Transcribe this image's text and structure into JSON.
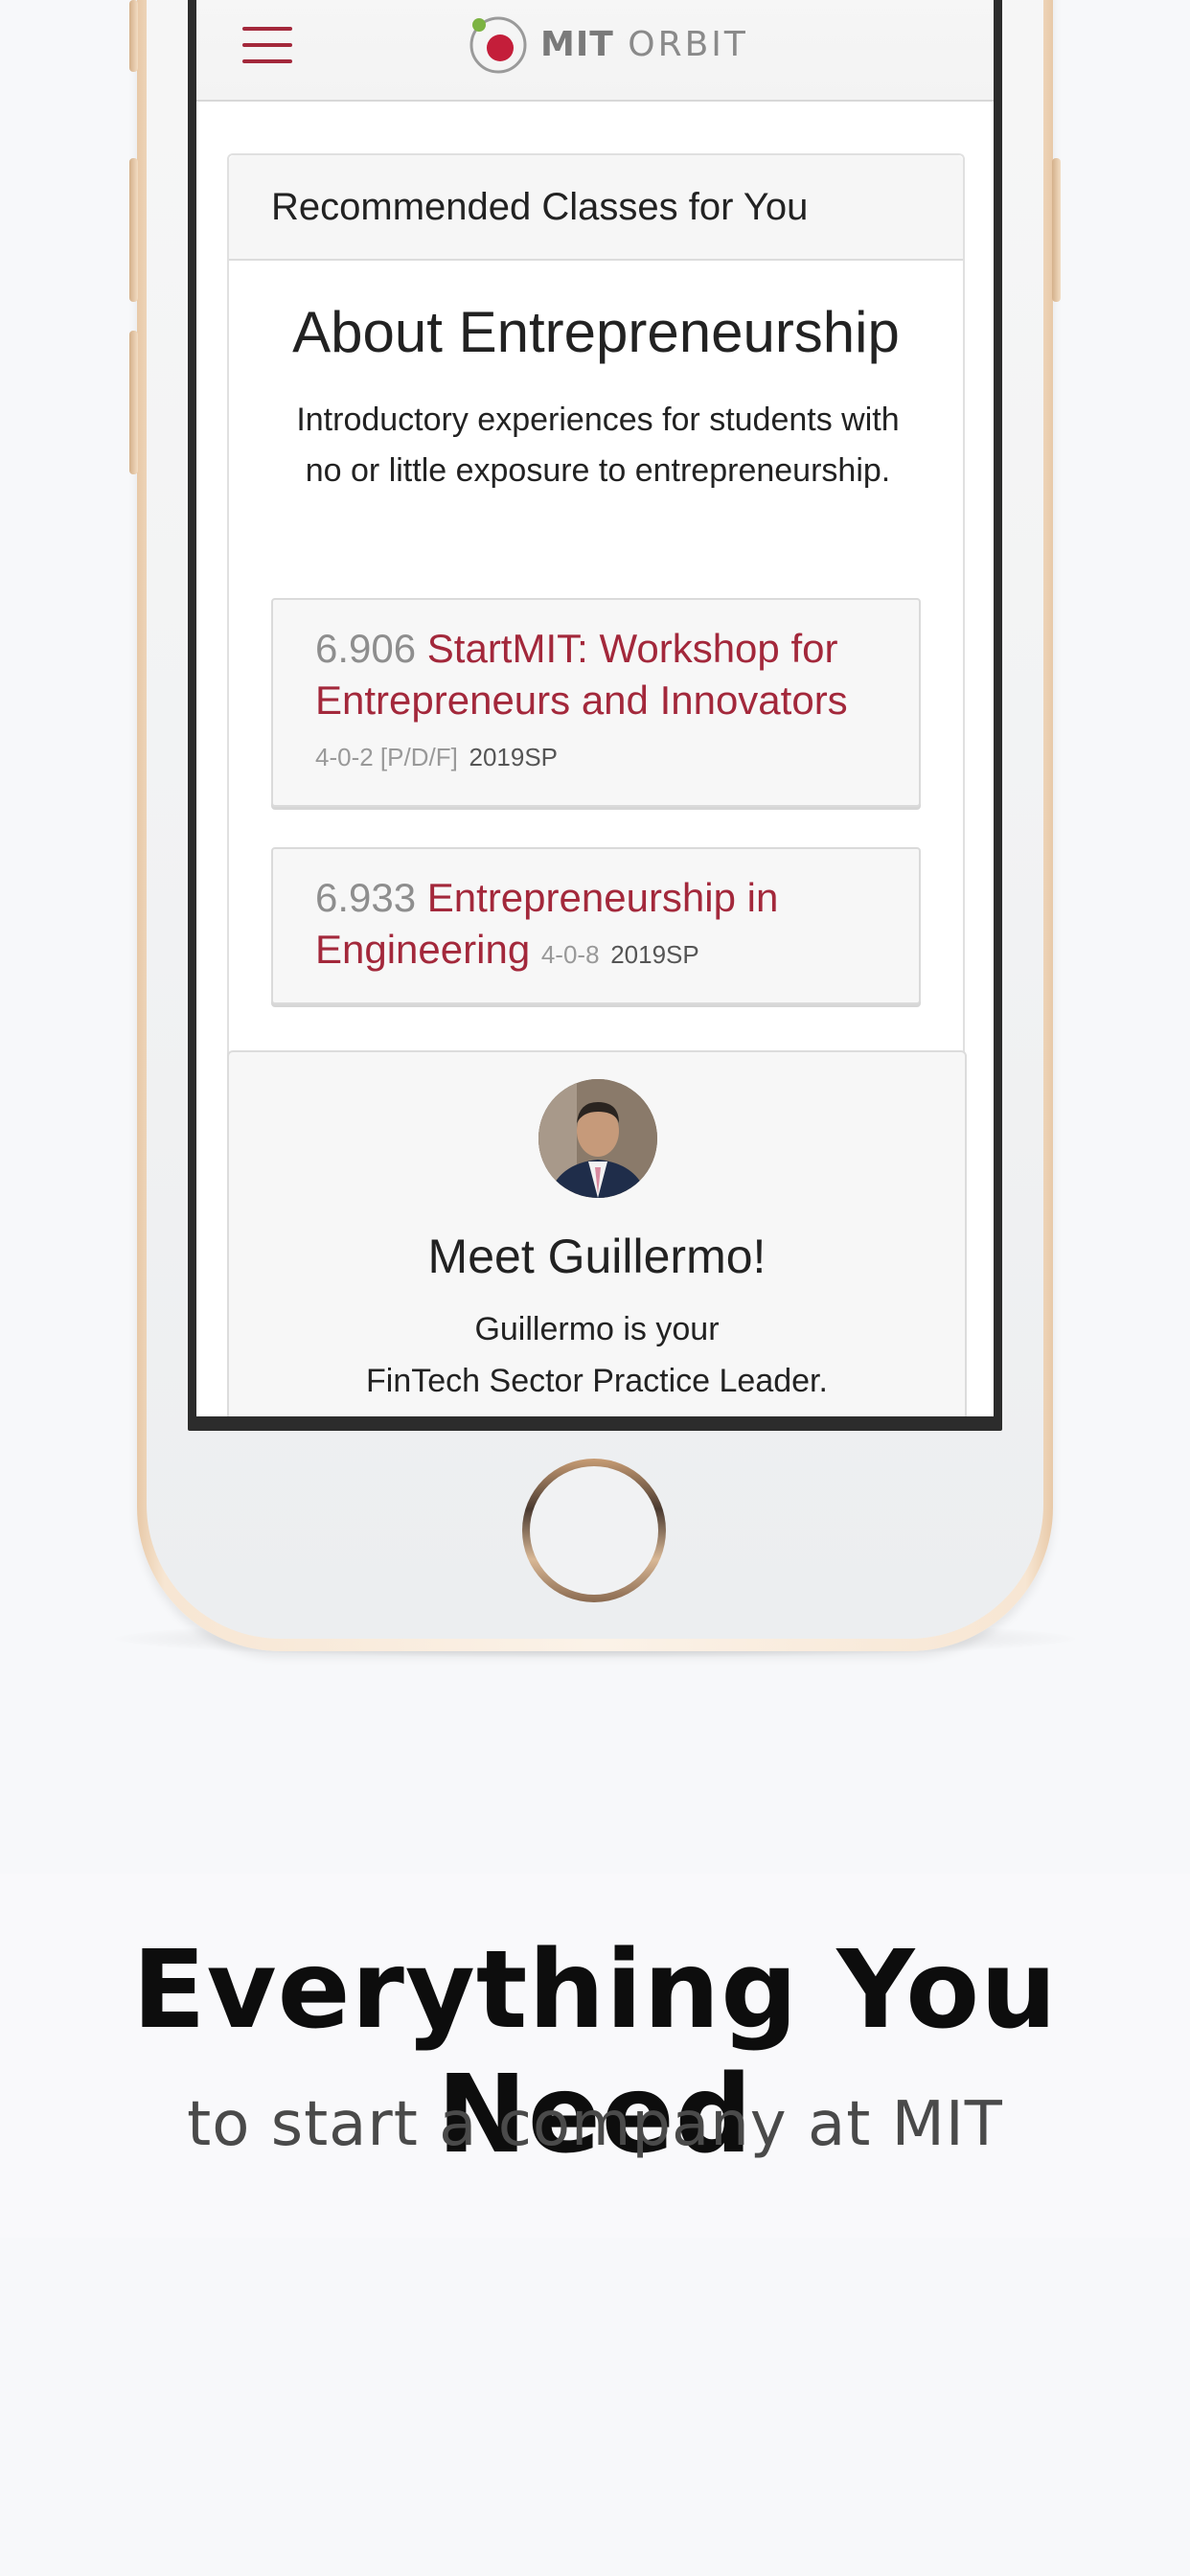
{
  "header": {
    "menu_icon": "hamburger-icon",
    "logo": {
      "bold": "MIT",
      "light": "ORBIT",
      "icon": "orbit-logo-icon",
      "accent_color": "#c41e3a",
      "dot_color": "#7cb342"
    }
  },
  "recommended": {
    "heading": "Recommended Classes for You",
    "section_title": "About Entrepreneurship",
    "section_description": "Introductory experiences for students with no or little exposure to entrepreneurship.",
    "classes": [
      {
        "number": "6.906",
        "title": "StartMIT: Workshop for Entrepreneurs and Innovators",
        "units": "4-0-2 [P/D/F]",
        "term": "2019SP"
      },
      {
        "number": "6.933",
        "title": "Entrepreneurship in Engineering",
        "units": "4-0-8",
        "term": "2019SP"
      }
    ]
  },
  "meet": {
    "title": "Meet Guillermo!",
    "line1": "Guillermo is your",
    "line2": "FinTech Sector Practice Leader."
  },
  "promo": {
    "headline": "Everything You Need",
    "subhead": "to start a company at MIT"
  },
  "colors": {
    "accent": "#a3283b",
    "text": "#222222",
    "muted": "#8e8e8e",
    "phone_gold": "#e8c9a8"
  }
}
